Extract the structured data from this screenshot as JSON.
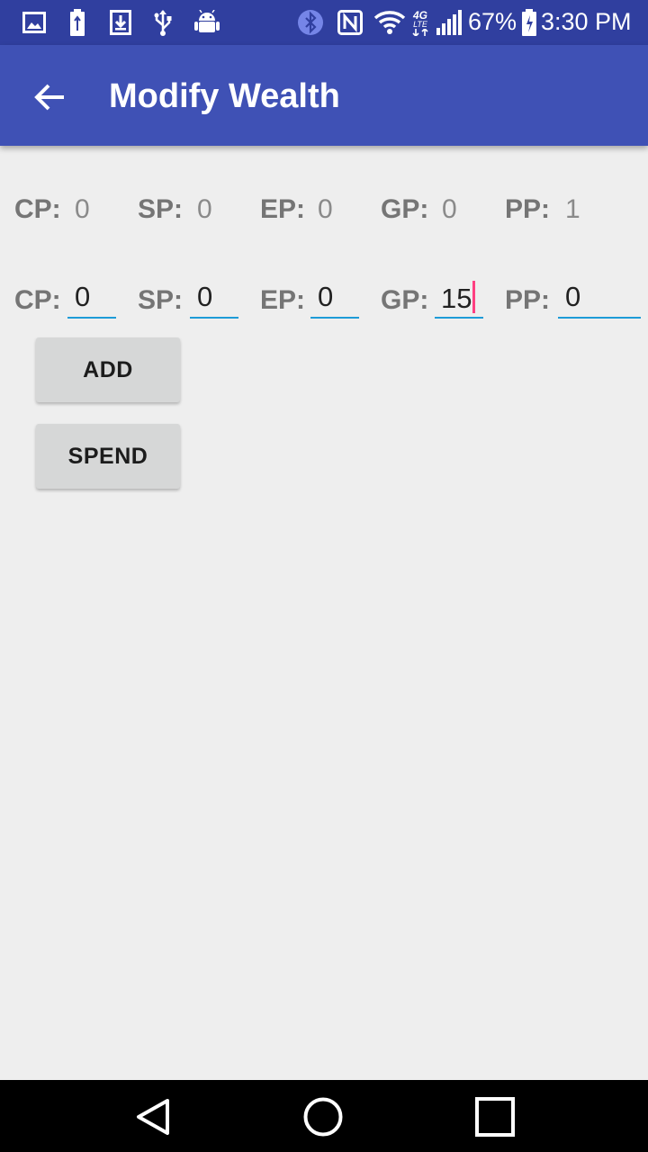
{
  "status_bar": {
    "battery_percent": "67%",
    "time": "3:30 PM",
    "icons": [
      "gallery-icon",
      "battery-saver-icon",
      "download-icon",
      "usb-icon",
      "android-icon",
      "bluetooth-icon",
      "nfc-icon",
      "wifi-icon",
      "lte-icon",
      "signal-icon",
      "battery-icon"
    ],
    "network_label": "4G"
  },
  "app_bar": {
    "title": "Modify Wealth",
    "back_icon": "arrow-back-icon"
  },
  "current_wealth": [
    {
      "label": "CP:",
      "value": "0"
    },
    {
      "label": "SP:",
      "value": "0"
    },
    {
      "label": "EP:",
      "value": "0"
    },
    {
      "label": "GP:",
      "value": "0"
    },
    {
      "label": "PP:",
      "value": "1"
    }
  ],
  "inputs": [
    {
      "label": "CP:",
      "value": "0"
    },
    {
      "label": "SP:",
      "value": "0"
    },
    {
      "label": "EP:",
      "value": "0"
    },
    {
      "label": "GP:",
      "value": "15"
    },
    {
      "label": "PP:",
      "value": "0"
    }
  ],
  "buttons": {
    "add": "ADD",
    "spend": "SPEND"
  },
  "colors": {
    "status_bar": "#303f9f",
    "app_bar": "#3f51b5",
    "field_underline": "#1e9bd7",
    "cursor": "#ff4081"
  },
  "nav_bar": {
    "icons": [
      "back-triangle-icon",
      "home-circle-icon",
      "recents-square-icon"
    ]
  }
}
